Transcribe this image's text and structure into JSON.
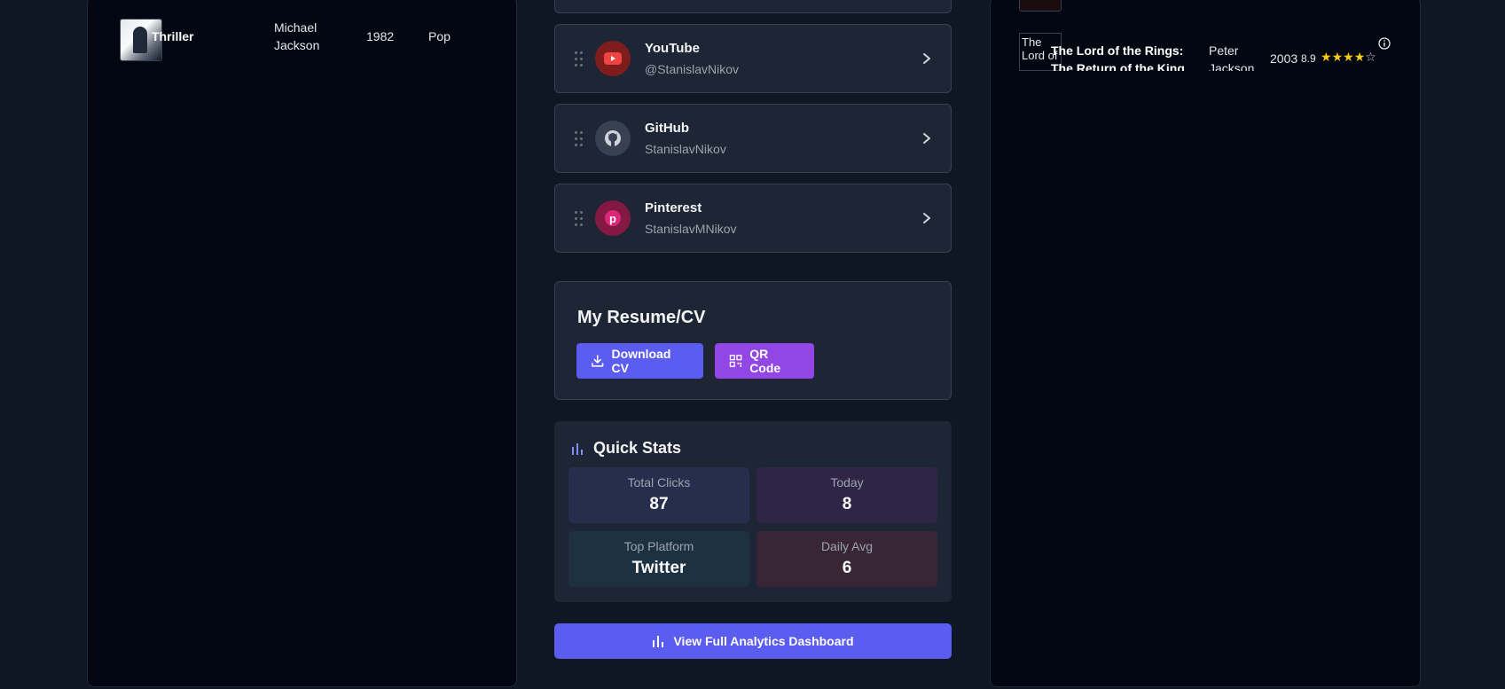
{
  "albums": {
    "rows": [
      {
        "title": "Thriller",
        "artist": "Michael Jackson",
        "year": "1982",
        "genre": "Pop"
      }
    ]
  },
  "links": {
    "items": [
      {
        "platform": "YouTube",
        "handle": "@StanislavNikov",
        "icon": "youtube-icon",
        "color": "#ef4444"
      },
      {
        "platform": "GitHub",
        "handle": "StanislavNikov",
        "icon": "github-icon",
        "color": "#4b5563"
      },
      {
        "platform": "Pinterest",
        "handle": "StanislavMNikov",
        "icon": "pinterest-icon",
        "color": "#db2777"
      }
    ]
  },
  "resume": {
    "title": "My Resume/CV",
    "download_label": "Download CV",
    "qr_label": "QR Code"
  },
  "stats": {
    "title": "Quick Stats",
    "total_clicks_label": "Total Clicks",
    "total_clicks_value": "87",
    "today_label": "Today",
    "today_value": "8",
    "top_platform_label": "Top Platform",
    "top_platform_value": "Twitter",
    "daily_avg_label": "Daily Avg",
    "daily_avg_value": "6"
  },
  "analytics": {
    "button_label": "View Full Analytics Dashboard"
  },
  "movies": {
    "rows": [
      {
        "thumb_alt": "The Lord of",
        "title": "The Lord of the Rings: The Return of the King",
        "director": "Peter Jackson",
        "year": "2003",
        "rating": "8.9",
        "stars_filled": 4,
        "stars_total": 5
      }
    ]
  },
  "colors": {
    "accent": "#5b5cf0",
    "purple": "#9346e6",
    "background": "#0f1624",
    "card": "#1e2636",
    "panel": "#030712"
  }
}
